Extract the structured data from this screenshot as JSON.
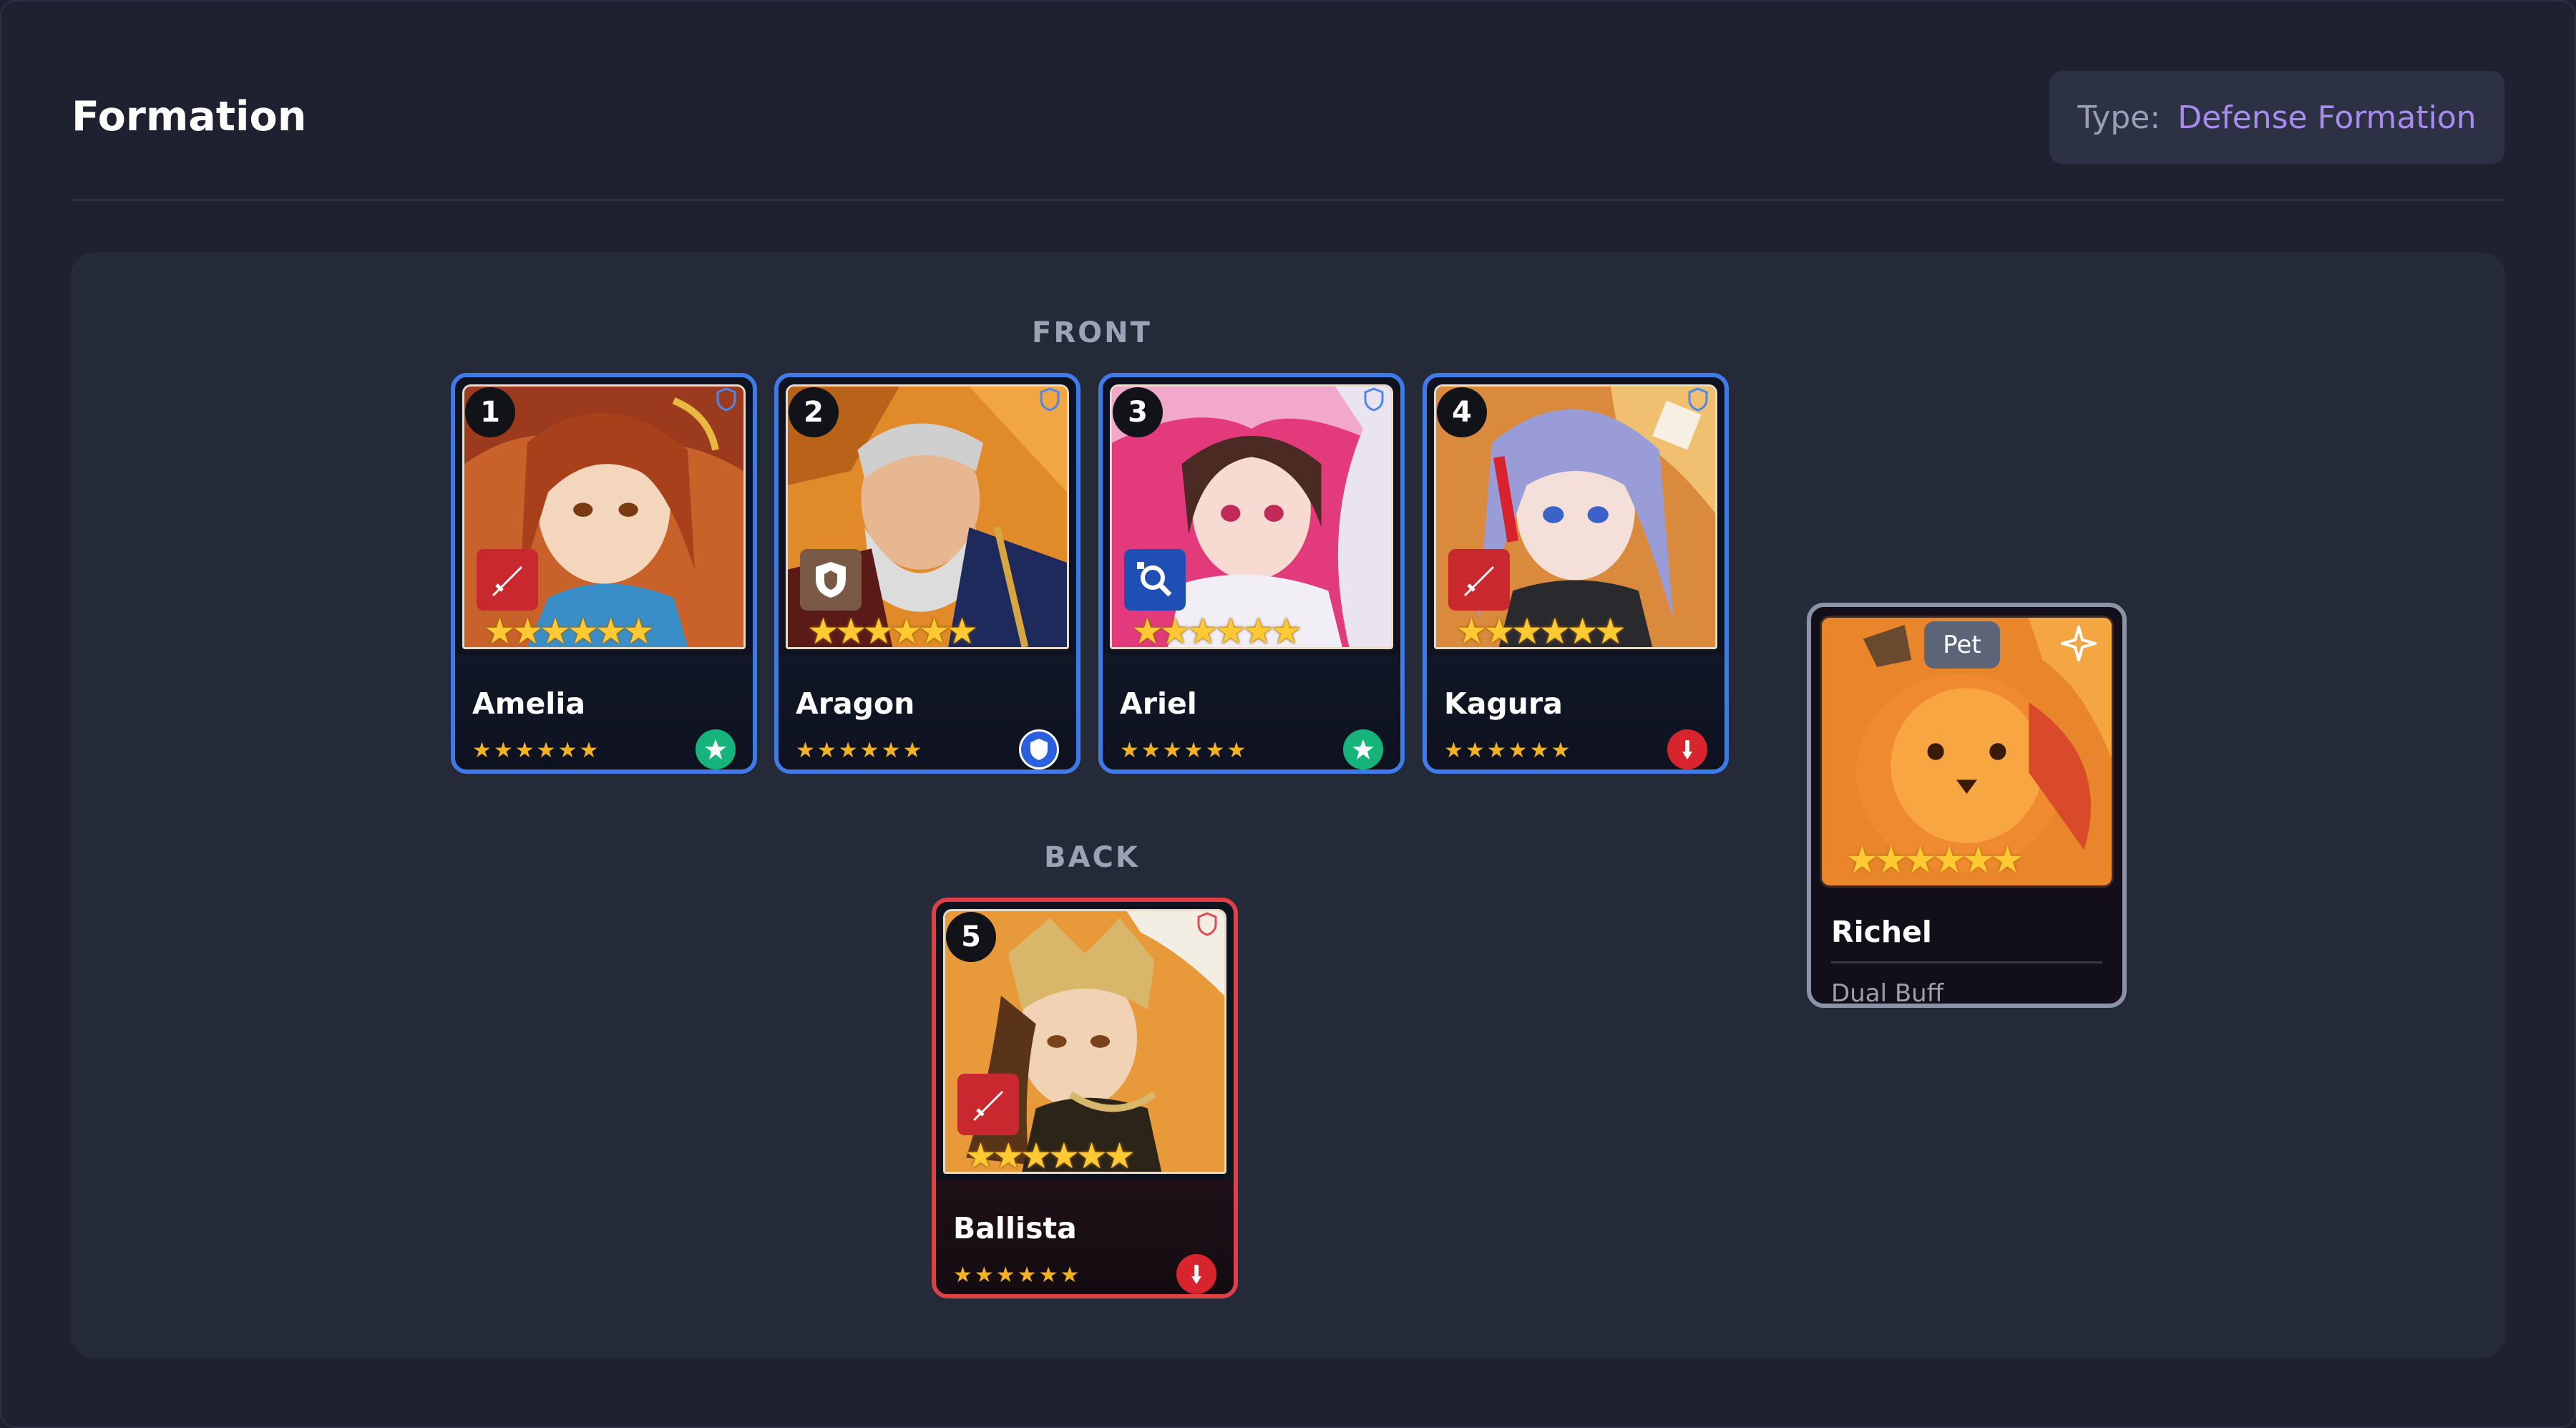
{
  "header": {
    "title": "Formation",
    "type_label": "Type:",
    "type_value": "Defense Formation"
  },
  "formation": {
    "front_label": "FRONT",
    "back_label": "BACK",
    "front": [
      {
        "slot": "1",
        "name": "Amelia",
        "stars": "★★★★★★",
        "art_stars": "★★★★★★",
        "class": "sword-icon",
        "element": "star-icon",
        "element_color": "#16b37a",
        "border": "#3e7be8"
      },
      {
        "slot": "2",
        "name": "Aragon",
        "stars": "★★★★★★",
        "art_stars": "★★★★★★",
        "class": "shield-icon",
        "element": "shield-icon",
        "element_color": "#2a5fe0",
        "border": "#3e7be8"
      },
      {
        "slot": "3",
        "name": "Ariel",
        "stars": "★★★★★★",
        "art_stars": "★★★★★★",
        "class": "magnifier-icon",
        "element": "star-icon",
        "element_color": "#16b37a",
        "border": "#3e7be8"
      },
      {
        "slot": "4",
        "name": "Kagura",
        "stars": "★★★★★★",
        "art_stars": "★★★★★★",
        "class": "sword-icon",
        "element": "exclamation-icon",
        "element_color": "#d8242c",
        "border": "#3e7be8"
      }
    ],
    "back": [
      {
        "slot": "5",
        "name": "Ballista",
        "stars": "★★★★★★",
        "art_stars": "★★★★★★",
        "class": "sword-icon",
        "element": "exclamation-icon",
        "element_color": "#d8242c",
        "border": "#dd4048"
      }
    ]
  },
  "pet": {
    "tag": "Pet",
    "name": "Richel",
    "description": "Dual Buff",
    "art_stars": "★★★★★★"
  }
}
